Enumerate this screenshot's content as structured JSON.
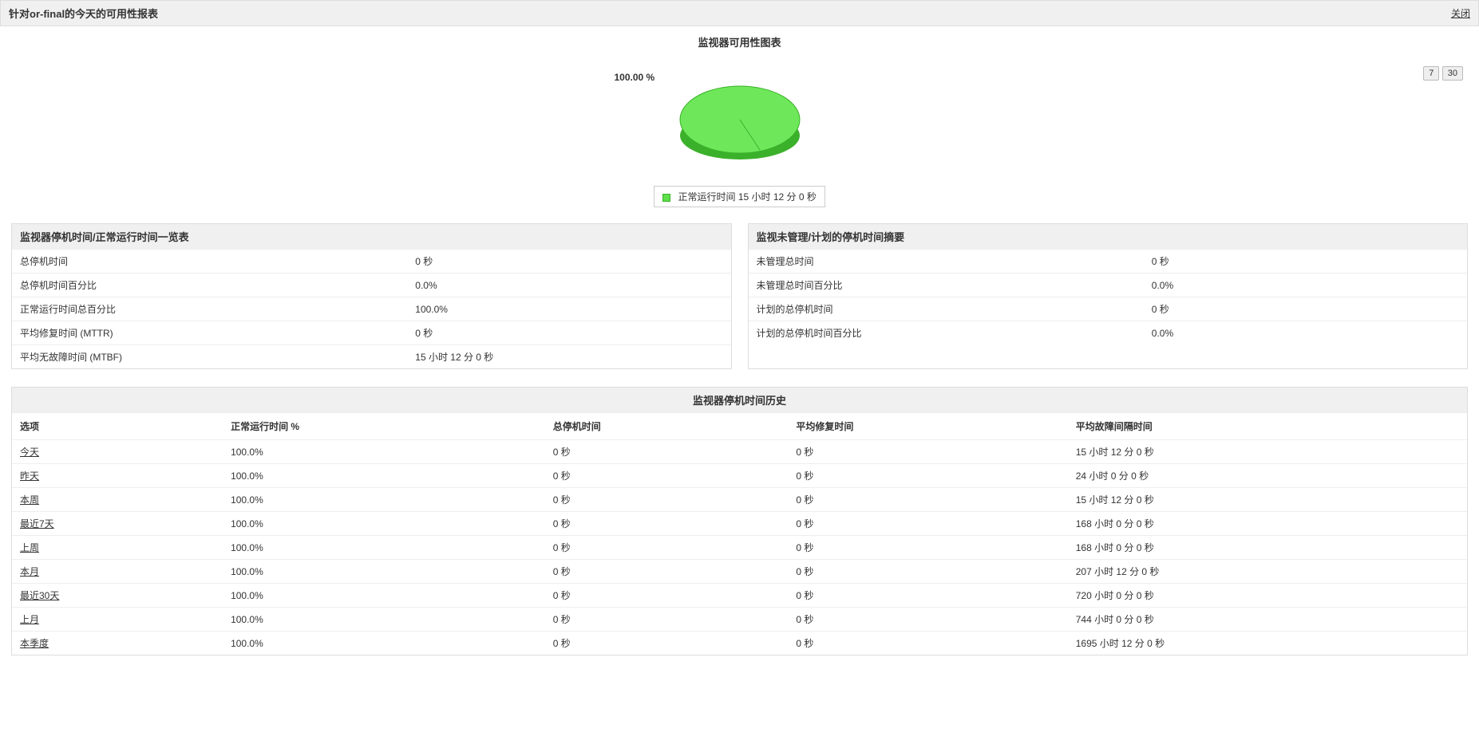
{
  "header": {
    "title": "针对or-final的今天的可用性报表",
    "close": "关闭"
  },
  "chart": {
    "title": "监视器可用性图表",
    "btn7": "7",
    "btn30": "30",
    "pct_label": "100.00 %",
    "legend_text": "正常运行时间 15 小时 12 分 0 秒"
  },
  "chart_data": {
    "type": "pie",
    "title": "监视器可用性图表",
    "series": [
      {
        "name": "正常运行时间 15 小时 12 分 0 秒",
        "value": 100.0,
        "color": "#5de04a"
      }
    ]
  },
  "downtime_panel": {
    "title": "监视器停机时间/正常运行时间一览表",
    "rows": [
      {
        "label": "总停机时间",
        "value": "0 秒"
      },
      {
        "label": "总停机时间百分比",
        "value": "0.0%"
      },
      {
        "label": "正常运行时间总百分比",
        "value": "100.0%"
      },
      {
        "label": "平均修复时间 (MTTR)",
        "value": "0 秒"
      },
      {
        "label": "平均无故障时间 (MTBF)",
        "value": "15 小时 12 分 0 秒"
      }
    ]
  },
  "unmanaged_panel": {
    "title": "监视未管理/计划的停机时间摘要",
    "rows": [
      {
        "label": "未管理总时间",
        "value": "0 秒"
      },
      {
        "label": "未管理总时间百分比",
        "value": "0.0%"
      },
      {
        "label": "计划的总停机时间",
        "value": "0 秒"
      },
      {
        "label": "计划的总停机时间百分比",
        "value": "0.0%"
      }
    ]
  },
  "history": {
    "title": "监视器停机时间历史",
    "headers": {
      "option": "选项",
      "uptime_pct": "正常运行时间 %",
      "total_down": "总停机时间",
      "mttr": "平均修复时间",
      "mtbf": "平均故障间隔时间"
    },
    "rows": [
      {
        "option": "今天",
        "uptime_pct": "100.0%",
        "total_down": "0 秒",
        "mttr": "0 秒",
        "mtbf": "15 小时 12 分 0 秒"
      },
      {
        "option": "昨天",
        "uptime_pct": "100.0%",
        "total_down": "0 秒",
        "mttr": "0 秒",
        "mtbf": "24 小时 0 分 0 秒"
      },
      {
        "option": "本周",
        "uptime_pct": "100.0%",
        "total_down": "0 秒",
        "mttr": "0 秒",
        "mtbf": "15 小时 12 分 0 秒"
      },
      {
        "option": "最近7天",
        "uptime_pct": "100.0%",
        "total_down": "0 秒",
        "mttr": "0 秒",
        "mtbf": "168 小时 0 分 0 秒"
      },
      {
        "option": "上周",
        "uptime_pct": "100.0%",
        "total_down": "0 秒",
        "mttr": "0 秒",
        "mtbf": "168 小时 0 分 0 秒"
      },
      {
        "option": "本月",
        "uptime_pct": "100.0%",
        "total_down": "0 秒",
        "mttr": "0 秒",
        "mtbf": "207 小时 12 分 0 秒"
      },
      {
        "option": "最近30天",
        "uptime_pct": "100.0%",
        "total_down": "0 秒",
        "mttr": "0 秒",
        "mtbf": "720 小时 0 分 0 秒"
      },
      {
        "option": "上月",
        "uptime_pct": "100.0%",
        "total_down": "0 秒",
        "mttr": "0 秒",
        "mtbf": "744 小时 0 分 0 秒"
      },
      {
        "option": "本季度",
        "uptime_pct": "100.0%",
        "total_down": "0 秒",
        "mttr": "0 秒",
        "mtbf": "1695 小时 12 分 0 秒"
      }
    ]
  }
}
